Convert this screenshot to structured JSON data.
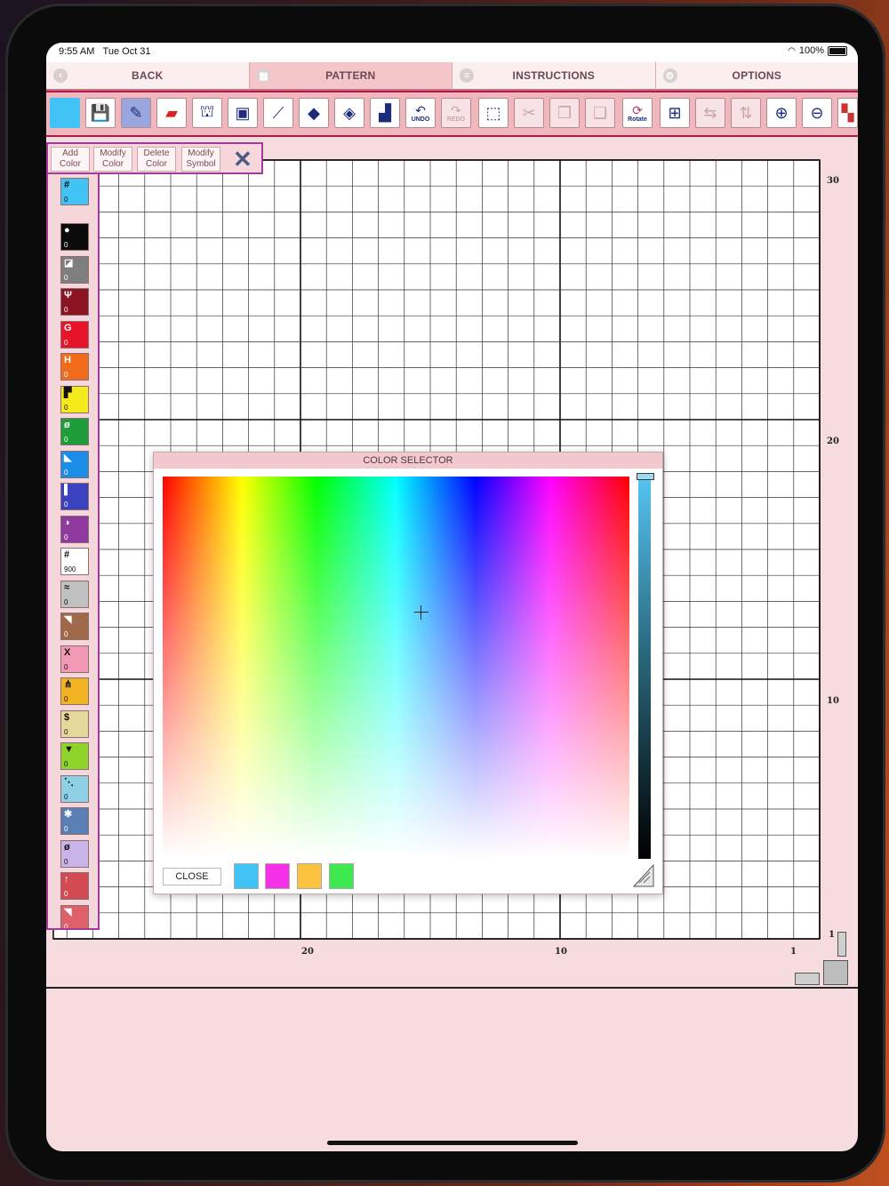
{
  "status_bar": {
    "time": "9:55 AM",
    "date": "Tue Oct 31",
    "battery": "100%"
  },
  "tabs": [
    {
      "label": "BACK",
      "icon": "chevron-left-icon",
      "active": false
    },
    {
      "label": "PATTERN",
      "icon": "grid-icon",
      "active": true
    },
    {
      "label": "INSTRUCTIONS",
      "icon": "list-icon",
      "active": false
    },
    {
      "label": "OPTIONS",
      "icon": "gear-icon",
      "active": false
    }
  ],
  "toolbar": {
    "undo_label": "UNDO",
    "redo_label": "REDO",
    "rotate_label": "Rotate",
    "current_color": "#41c4f5"
  },
  "color_tools": {
    "add": "Add Color",
    "modify": "Modify Color",
    "delete": "Delete Color",
    "symbol": "Modify Symbol"
  },
  "selected_swatch": {
    "symbol": "#",
    "count": "0",
    "color": "#41c4f5"
  },
  "palette": [
    {
      "symbol": "●",
      "count": "0",
      "color": "#0b0b0b"
    },
    {
      "symbol": "◪",
      "count": "0",
      "color": "#7e7e7e"
    },
    {
      "symbol": "Ψ",
      "count": "0",
      "color": "#8b1423"
    },
    {
      "symbol": "G",
      "count": "0",
      "color": "#e8142a"
    },
    {
      "symbol": "H",
      "count": "0",
      "color": "#f06c1a"
    },
    {
      "symbol": "▛",
      "count": "0",
      "color": "#f4ea1c"
    },
    {
      "symbol": "ø",
      "count": "0",
      "color": "#1d9e3a"
    },
    {
      "symbol": "◣",
      "count": "0",
      "color": "#1a8ee6"
    },
    {
      "symbol": "▌",
      "count": "0",
      "color": "#3a42c0"
    },
    {
      "symbol": "◑",
      "count": "0",
      "color": "#8e3a9e"
    },
    {
      "symbol": "#",
      "count": "900",
      "color": "#ffffff"
    },
    {
      "symbol": "≈",
      "count": "0",
      "color": "#c0c0c0"
    },
    {
      "symbol": "◥",
      "count": "0",
      "color": "#a06a4a"
    },
    {
      "symbol": "X",
      "count": "0",
      "color": "#f29ab5"
    },
    {
      "symbol": "⋔",
      "count": "0",
      "color": "#f2b323"
    },
    {
      "symbol": "$",
      "count": "0",
      "color": "#e6d89a"
    },
    {
      "symbol": "▼",
      "count": "0",
      "color": "#8fd42a"
    },
    {
      "symbol": "⋱",
      "count": "0",
      "color": "#8ed0e6"
    },
    {
      "symbol": "✱",
      "count": "0",
      "color": "#5a7fb4"
    },
    {
      "symbol": "ø",
      "count": "0",
      "color": "#c8b4e6"
    },
    {
      "symbol": "↑",
      "count": "0",
      "color": "#d24a52"
    },
    {
      "symbol": "◥",
      "count": "0",
      "color": "#e0606a"
    }
  ],
  "grid": {
    "y_labels": [
      "30",
      "20",
      "10",
      "1"
    ],
    "x_labels": [
      "20",
      "10",
      "1"
    ]
  },
  "color_selector": {
    "title": "COLOR SELECTOR",
    "close_label": "CLOSE",
    "recent_colors": [
      "#41c4f5",
      "#f531e7",
      "#fbc33f",
      "#3ee84f"
    ]
  }
}
